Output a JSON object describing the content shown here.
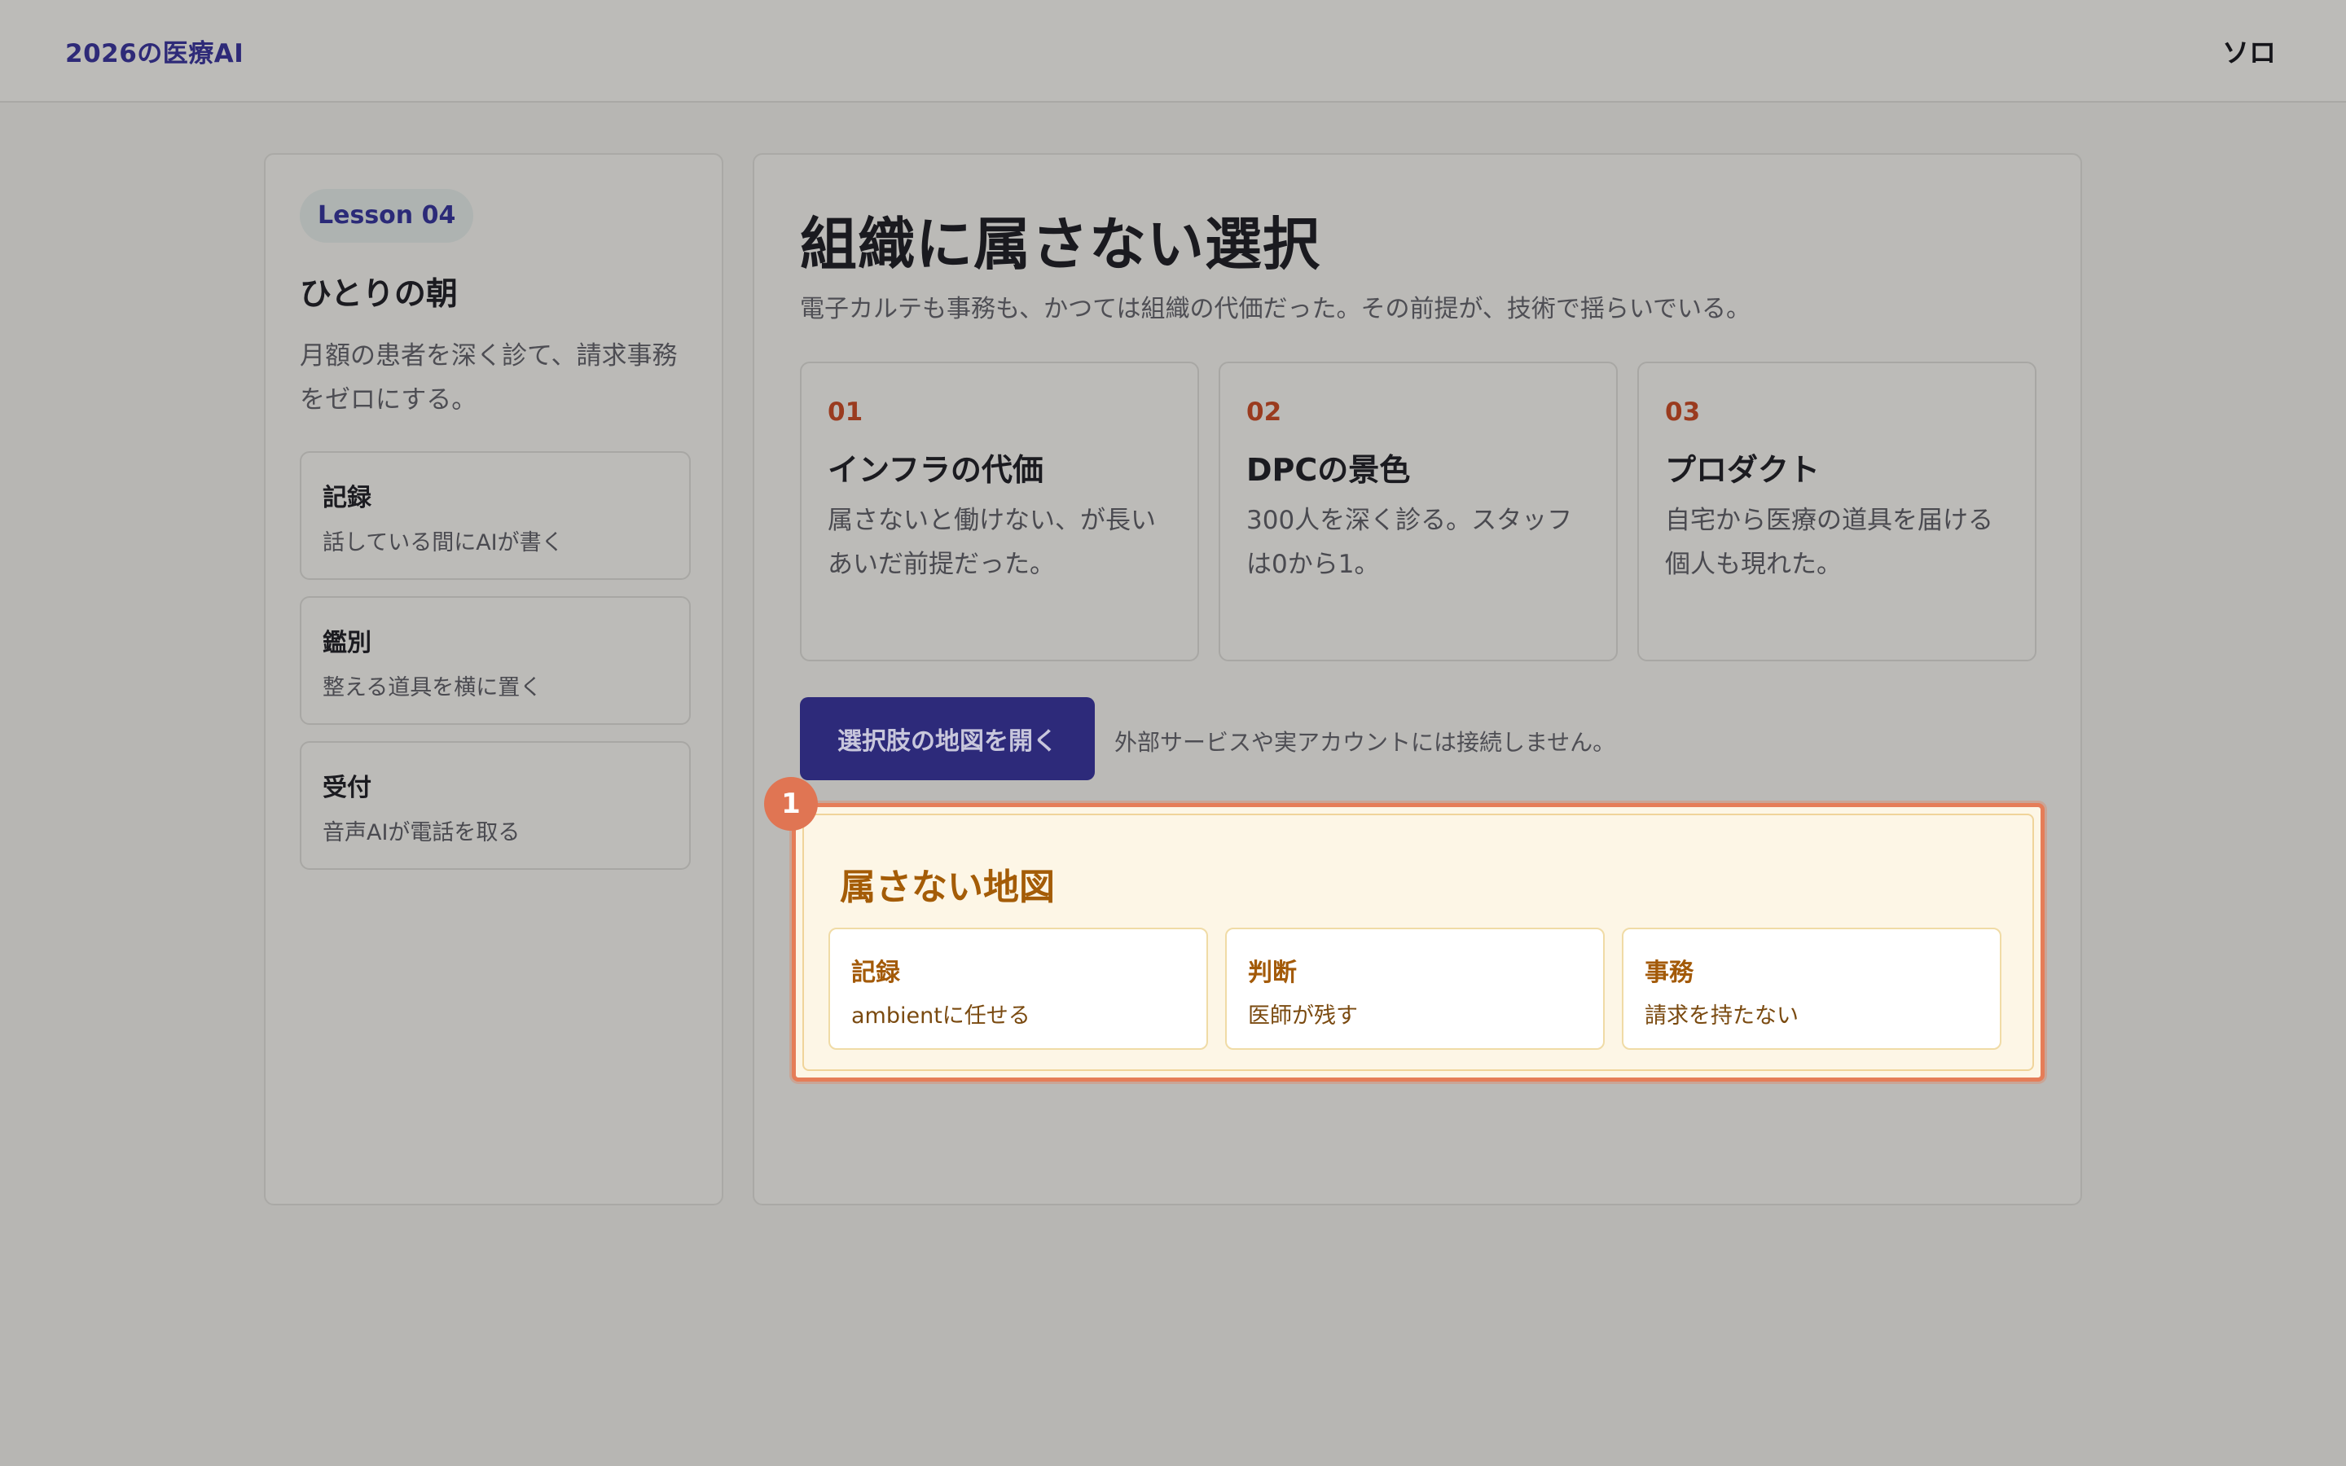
{
  "header": {
    "brand": "2026の医療AI",
    "mode": "ソロ"
  },
  "sidebar": {
    "lesson_label": "Lesson 04",
    "title": "ひとりの朝",
    "description": "月額の患者を深く診て、請求事務をゼロにする。",
    "items": [
      {
        "title": "記録",
        "desc": "話している間にAIが書く"
      },
      {
        "title": "鑑別",
        "desc": "整える道具を横に置く"
      },
      {
        "title": "受付",
        "desc": "音声AIが電話を取る"
      }
    ]
  },
  "main": {
    "title": "組織に属さない選択",
    "subtitle": "電子カルテも事務も、かつては組織の代価だった。その前提が、技術で揺らいでいる。",
    "cards": [
      {
        "num": "01",
        "title": "インフラの代価",
        "desc": "属さないと働けない、が長いあいだ前提だった。"
      },
      {
        "num": "02",
        "title": "DPCの景色",
        "desc": "300人を深く診る。スタッフは0から1。"
      },
      {
        "num": "03",
        "title": "プロダクト",
        "desc": "自宅から医療の道具を届ける個人も現れた。"
      }
    ],
    "open_button": "選択肢の地図を開く",
    "note": "外部サービスや実アカウントには接続しません。"
  },
  "map": {
    "badge": "1",
    "title": "属さない地図",
    "items": [
      {
        "title": "記録",
        "desc": "ambientに任せる"
      },
      {
        "title": "判断",
        "desc": "医師が残す"
      },
      {
        "title": "事務",
        "desc": "請求を持たない"
      }
    ]
  },
  "colors": {
    "accent": "#2d2a7a",
    "highlight_border": "#e57d58",
    "map_title": "#a45c07",
    "card_number": "#9a3b1f"
  }
}
